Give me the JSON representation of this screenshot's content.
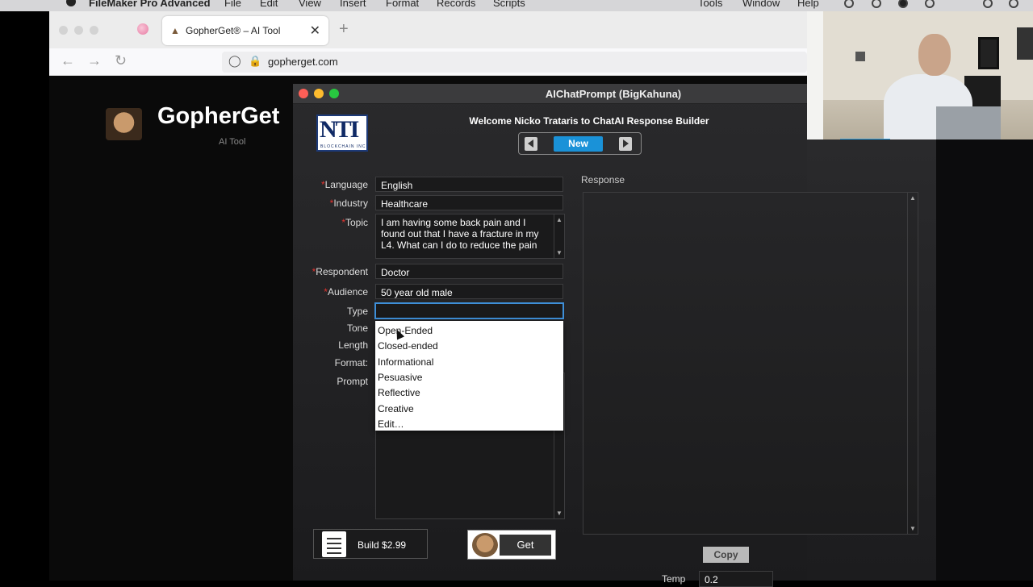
{
  "menubar": {
    "app": "FileMaker Pro Advanced",
    "items": [
      "File",
      "Edit",
      "View",
      "Insert",
      "Format",
      "Records",
      "Scripts",
      "Tools",
      "Window",
      "Help"
    ]
  },
  "browser": {
    "tab_title": "GopherGet® – AI Tool",
    "url": "gopherget.com",
    "new_tab": "+",
    "close": "✕"
  },
  "site": {
    "title": "GopherGet",
    "subtitle": "AI Tool"
  },
  "fm": {
    "window_title": "AIChatPrompt (BigKahuna)",
    "logo_text": "NTI",
    "logo_sub": "BLOCKCHAIN INC",
    "welcome": "Welcome Nicko Trataris to ChatAI Response Builder",
    "new_label": "New",
    "fields": {
      "language": {
        "label": "Language",
        "value": "English"
      },
      "industry": {
        "label": "Industry",
        "value": "Healthcare"
      },
      "topic": {
        "label": "Topic",
        "value": "I am having some back pain and I found out that I have a fracture in my L4. What can I do to reduce the pain"
      },
      "respondent": {
        "label": "Respondent",
        "value": "Doctor"
      },
      "audience": {
        "label": "Audience",
        "value": "50 year old male"
      },
      "type": {
        "label": "Type",
        "value": ""
      },
      "tone": {
        "label": "Tone"
      },
      "length": {
        "label": "Length"
      },
      "format": {
        "label": "Format:"
      },
      "prompt": {
        "label": "Prompt"
      }
    },
    "type_options": [
      "Open-Ended",
      "Closed-ended",
      "Informational",
      "Pesuasive",
      "Reflective",
      "Creative",
      "Edit…"
    ],
    "response_label": "Response",
    "build_label": "Build $2.99",
    "get_label": "Get",
    "copy_label": "Copy",
    "temp_label": "Temp",
    "temp_value": "0.2"
  },
  "colors": {
    "accent_blue": "#1a92d8",
    "required_star": "#e0332f"
  }
}
